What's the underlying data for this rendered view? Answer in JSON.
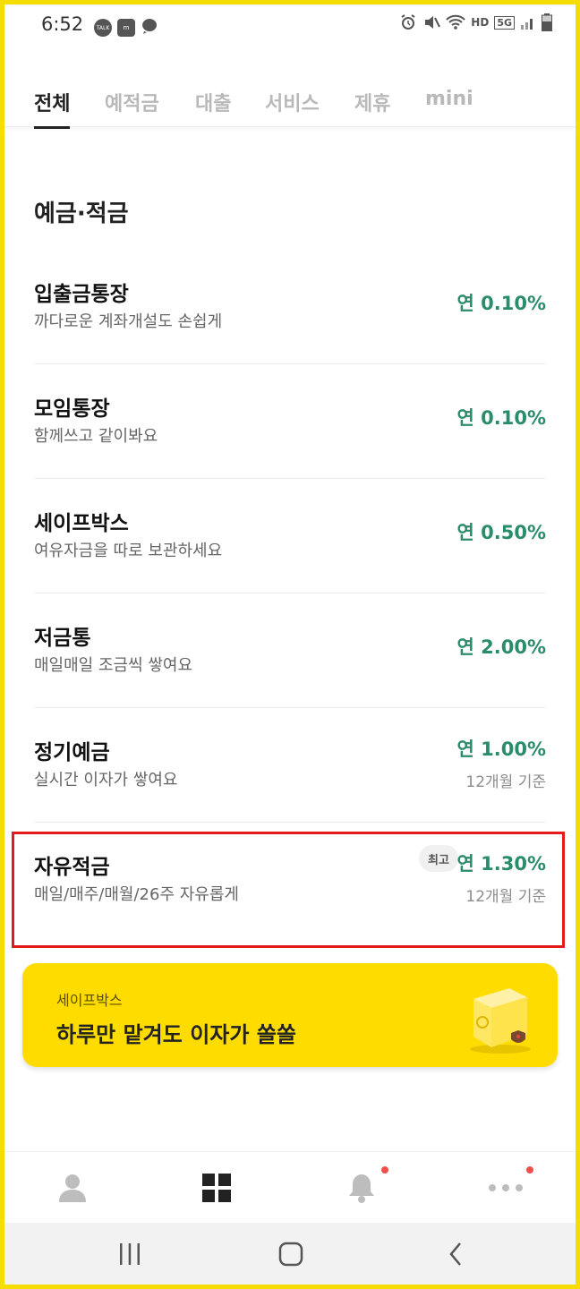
{
  "status_bar": {
    "time": "6:52",
    "left_icons": [
      "talk-icon",
      "global-icon",
      "chat-icon"
    ],
    "right_icons": [
      "alarm-icon",
      "mute-icon",
      "wifi-icon",
      "hd-voice-icon",
      "5g-icon",
      "signal-icon",
      "battery-icon"
    ],
    "hd_label": "HD",
    "five_g_label": "5G"
  },
  "tabs": [
    {
      "label": "전체",
      "active": true
    },
    {
      "label": "예적금",
      "active": false
    },
    {
      "label": "대출",
      "active": false
    },
    {
      "label": "서비스",
      "active": false
    },
    {
      "label": "제휴",
      "active": false
    },
    {
      "label": "mini",
      "active": false
    }
  ],
  "section": {
    "title": "예금·적금"
  },
  "products": [
    {
      "title": "입출금통장",
      "desc": "까다로운 계좌개설도 손쉽게",
      "rate": "연 0.10%"
    },
    {
      "title": "모임통장",
      "desc": "함께쓰고 같이봐요",
      "rate": "연 0.10%"
    },
    {
      "title": "세이프박스",
      "desc": "여유자금을 따로 보관하세요",
      "rate": "연 0.50%"
    },
    {
      "title": "저금통",
      "desc": "매일매일 조금씩 쌓여요",
      "rate": "연 2.00%"
    },
    {
      "title": "정기예금",
      "desc": "실시간 이자가 쌓여요",
      "rate": "연 1.00%",
      "sub": "12개월 기준"
    },
    {
      "title": "자유적금",
      "desc": "매일/매주/매월/26주 자유롭게",
      "rate": "연 1.30%",
      "sub": "12개월 기준",
      "badge": "최고"
    }
  ],
  "banner": {
    "subtitle": "세이프박스",
    "title": "하루만 맡겨도 이자가 쏠쏠"
  },
  "bottom_nav": [
    "profile-icon",
    "grid-icon",
    "bell-icon",
    "more-icon"
  ],
  "colors": {
    "accent_yellow": "#ffdc00",
    "rate_green": "#2a8c6b",
    "highlight_red": "#e41b1b"
  }
}
